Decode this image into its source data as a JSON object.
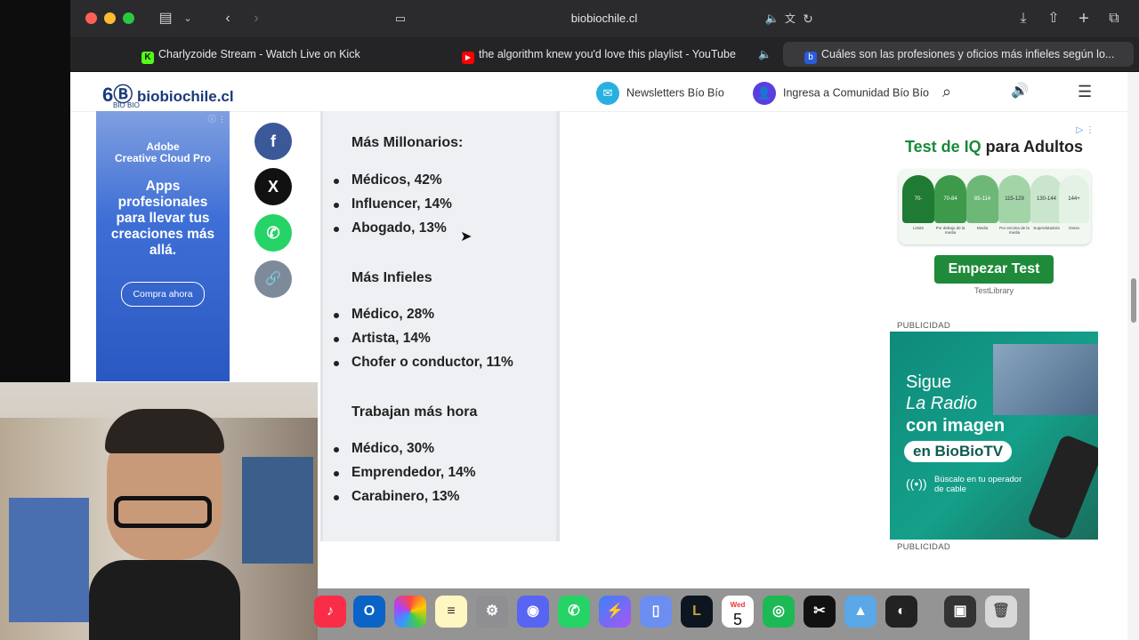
{
  "browser": {
    "url": "biobiochile.cl",
    "tabs": [
      {
        "label": "Charlyzoide Stream - Watch Live on Kick",
        "favicon_color": "#53fc18",
        "favicon_text": "K"
      },
      {
        "label": "the algorithm knew you'd love this playlist - YouTube",
        "favicon_color": "#ff0000",
        "favicon_text": "▶"
      },
      {
        "label": "Cuáles son las profesiones y oficios más infieles según lo...",
        "favicon_color": "#2a5bd7",
        "favicon_text": "b"
      }
    ]
  },
  "site": {
    "logo_text": "biobiochile.cl",
    "logo_sub": "BIO BIO",
    "newsletters": "Newsletters Bío Bío",
    "community": "Ingresa a Comunidad Bío Bío"
  },
  "ad_left": {
    "brand": "Adobe\nCreative Cloud Pro",
    "headline": "Apps profesionales para llevar tus creaciones más allá.",
    "cta": "Compra ahora"
  },
  "share": {
    "facebook": "f",
    "x": "X",
    "whatsapp": "✆",
    "link": "🔗"
  },
  "article": {
    "sections": [
      {
        "title": "Más Millonarios:",
        "items": [
          "Médicos, 42%",
          "Influencer, 14%",
          "Abogado, 13%"
        ]
      },
      {
        "title": "Más Infieles",
        "items": [
          "Médico, 28%",
          "Artista, 14%",
          "Chofer o conductor, 11%"
        ]
      },
      {
        "title": "Trabajan más hora",
        "items": [
          "Médico, 30%",
          "Emprendedor, 14%",
          "Carabinero, 13%"
        ]
      }
    ]
  },
  "ad_right1": {
    "title_part1": "Test de IQ",
    "title_part2": "para Adultos",
    "scale": [
      "70-",
      "70-84",
      "85-114",
      "115-129",
      "130-144",
      "144+"
    ],
    "scale_labels": [
      "Limite",
      "Por debajo de la media",
      "Media",
      "Por encima de la media",
      "Superdotado/a",
      "Genio"
    ],
    "cta": "Empezar Test",
    "sponsor": "TestLibrary"
  },
  "ad_right2": {
    "line1": "Sigue",
    "line2": "La Radio",
    "line3": "con imagen",
    "line4": "en BioBioTV",
    "sub": "Búscalo en tu operador de cable"
  },
  "publicidad_label": "PUBLICIDAD",
  "dock": {
    "calendar_day": "5",
    "calendar_month": "Wed"
  }
}
